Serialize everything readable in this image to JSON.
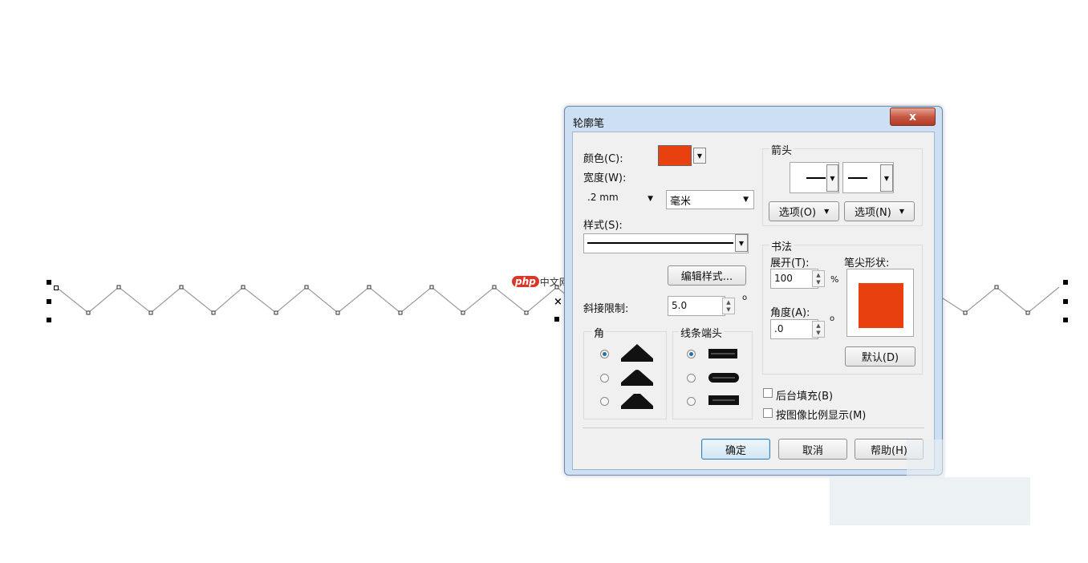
{
  "watermark": {
    "logo": "php",
    "text": "中文网"
  },
  "dialog": {
    "title": "轮廓笔",
    "close_label": "x",
    "color_label": "颜色(C):",
    "color_value": "#e8410f",
    "width_label": "宽度(W):",
    "width_value": ".2 mm",
    "unit_value": "毫米",
    "style_label": "样式(S):",
    "edit_style_button": "编辑样式...",
    "miter_label": "斜接限制:",
    "miter_value": "5.0",
    "degree_symbol": "o",
    "corner_group": "角",
    "linecap_group": "线条端头",
    "corner_selected": 0,
    "linecap_selected": 0,
    "arrow_group": "箭头",
    "arrow_options_left": "选项(O)",
    "arrow_options_right": "选项(N)",
    "calligraphy_group": "书法",
    "stretch_label": "展开(T):",
    "stretch_value": "100",
    "percent_symbol": "%",
    "nib_shape_label": "笔尖形状:",
    "angle_label": "角度(A):",
    "angle_value": ".0",
    "default_button": "默认(D)",
    "behind_fill_label": "后台填充(B)",
    "scale_with_image_label": "按图像比例显示(M)",
    "ok_button": "确定",
    "cancel_button": "取消",
    "help_button": "帮助(H)",
    "nib_color": "#e8410f"
  }
}
